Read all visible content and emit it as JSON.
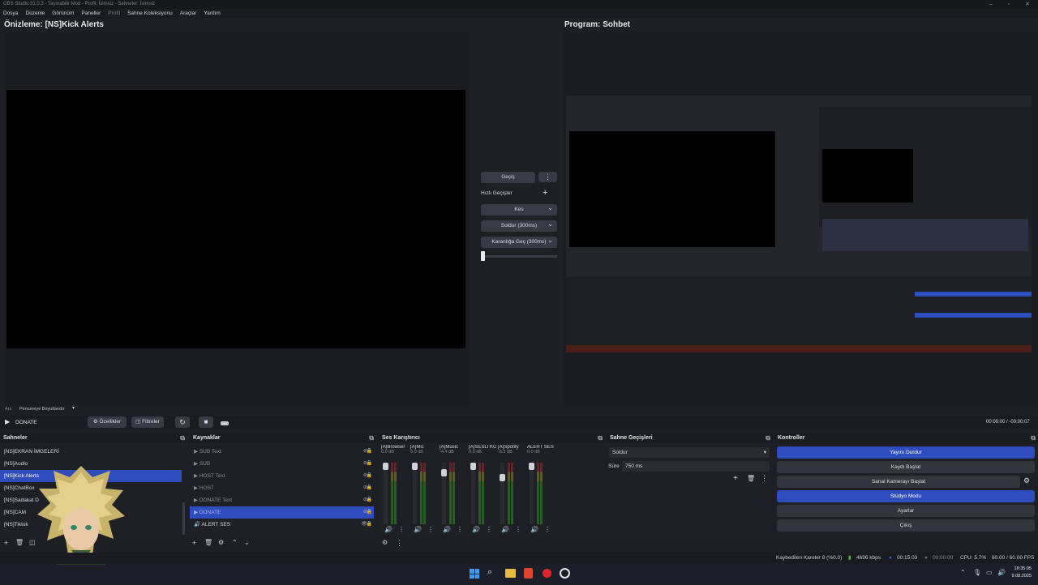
{
  "window": {
    "title": "OBS Studio 31.0.3 - Taşınabilir Mod - Profil: İsimsiz - Sahneler: İsimsiz"
  },
  "menu": [
    "Dosya",
    "Düzenle",
    "Görünüm",
    "Paneller",
    "Profil",
    "Sahne Koleksiyonu",
    "Araçlar",
    "Yardım"
  ],
  "preview": {
    "title": "Önizleme: [NS]Kick Alerts",
    "scale_label": "Ars",
    "scale_value": "Pencereye Boyutlandır"
  },
  "program": {
    "title": "Program: Sohbet"
  },
  "transition": {
    "button": "Geçiş",
    "quick_label": "Hızlı Geçişler",
    "items": [
      "Kes",
      "Soldur (300ms)",
      "Karanlığa Geç (300ms)"
    ]
  },
  "media": {
    "scene_label": "DONATE",
    "properties": "Özellikler",
    "filters": "Filtreler",
    "time": "00:00:00 / -00:00:07"
  },
  "scenes": {
    "title": "Sahneler",
    "items": [
      "[NS]EKRAN İMGELERİ",
      "[NS]Audio",
      "[NS]Kick Alerts",
      "[NS]ChatBox",
      "[NS]Sadakat D",
      "[NS]CAM",
      "[NS]Tiktok"
    ],
    "selected": 2
  },
  "sources": {
    "title": "Kaynaklar",
    "items": [
      "SUB Text",
      "SUB",
      "HOST Text",
      "HOST",
      "DONATE Text",
      "DONATE",
      "ALERT SES"
    ]
  },
  "mixer": {
    "title": "Ses Karıştırıcı",
    "channels": [
      {
        "name": "[A]Browser",
        "db": "0.0 dB"
      },
      {
        "name": "[A]Mic",
        "db": "0.0 dB"
      },
      {
        "name": "[A]Music",
        "db": "-4.4 dB"
      },
      {
        "name": "[A]SESLI KONUŞ",
        "db": "0.0 dB"
      },
      {
        "name": "[A]Spotify",
        "db": "-8.3 dB"
      },
      {
        "name": "ALERT SES",
        "db": "0.0 dB"
      }
    ],
    "ticks": [
      "0",
      "-5",
      "-10",
      "-15",
      "-20",
      "-25",
      "-30",
      "-35",
      "-40",
      "-45",
      "-50",
      "-55",
      "-60"
    ]
  },
  "transitions_panel": {
    "title": "Sahne Geçişleri",
    "type": "Soldur",
    "duration_label": "Süre",
    "duration": "750 ms"
  },
  "controls": {
    "title": "Kontroller",
    "buttons": [
      "Yayını Durdur",
      "Kaydı Başlat",
      "Sanal Kamerayı Başlat",
      "Stüdyo Modu",
      "Ayarlar",
      "Çıkış"
    ]
  },
  "status": {
    "dropped": "Kaybedilen Kareler 8 (%0.0)",
    "bitrate": "4696 kbps",
    "stream_time": "00:15:03",
    "rec_time": "00:00:00",
    "cpu": "CPU: 5.7%",
    "fps": "60.00 / 60.00 FPS"
  },
  "taskbar": {
    "time": "18:35:05",
    "date": "9.08.2025"
  },
  "colors": {
    "accent": "#2f4cbf",
    "bg": "#1e1f24",
    "panel": "#1b1c21"
  }
}
